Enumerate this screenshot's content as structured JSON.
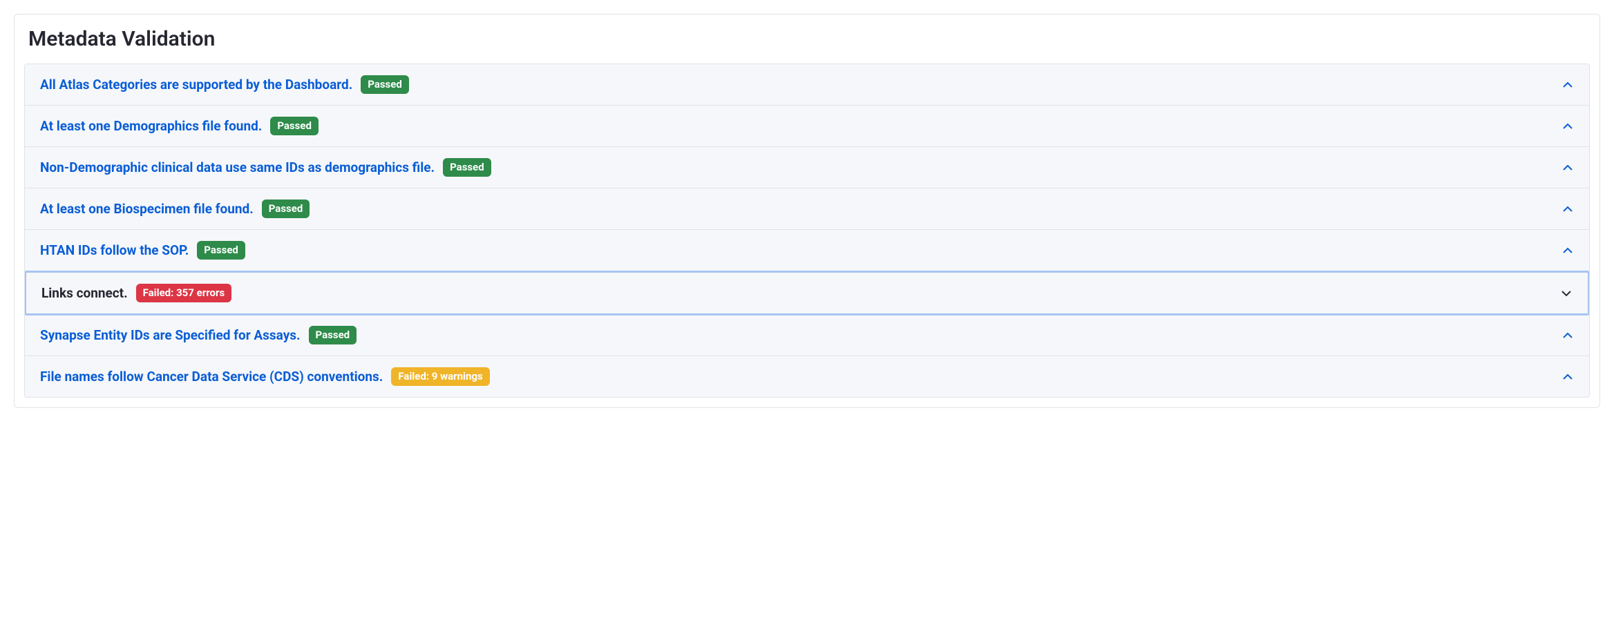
{
  "panel_title": "Metadata Validation",
  "items": [
    {
      "title": "All Atlas Categories are supported by the Dashboard.",
      "badge": "Passed",
      "badge_type": "passed",
      "selected": false,
      "expanded": false
    },
    {
      "title": "At least one Demographics file found.",
      "badge": "Passed",
      "badge_type": "passed",
      "selected": false,
      "expanded": false
    },
    {
      "title": "Non-Demographic clinical data use same IDs as demographics file.",
      "badge": "Passed",
      "badge_type": "passed",
      "selected": false,
      "expanded": false
    },
    {
      "title": "At least one Biospecimen file found.",
      "badge": "Passed",
      "badge_type": "passed",
      "selected": false,
      "expanded": false
    },
    {
      "title": "HTAN IDs follow the SOP.",
      "badge": "Passed",
      "badge_type": "passed",
      "selected": false,
      "expanded": false
    },
    {
      "title": "Links connect.",
      "badge": "Failed: 357 errors",
      "badge_type": "failed-error",
      "selected": true,
      "expanded": true
    },
    {
      "title": "Synapse Entity IDs are Specified for Assays.",
      "badge": "Passed",
      "badge_type": "passed",
      "selected": false,
      "expanded": false
    },
    {
      "title": "File names follow Cancer Data Service (CDS) conventions.",
      "badge": "Failed: 9 warnings",
      "badge_type": "failed-warning",
      "selected": false,
      "expanded": false
    }
  ]
}
